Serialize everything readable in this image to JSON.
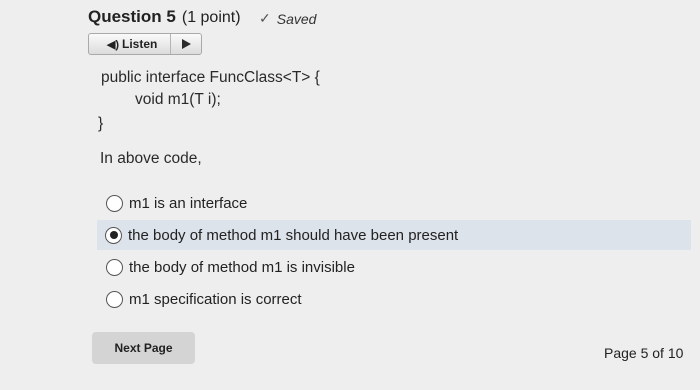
{
  "header": {
    "question": "Question 5",
    "points": "(1 point)",
    "status_icon": "check-icon",
    "status": "Saved"
  },
  "listen": {
    "label": "Listen",
    "speaker_icon": "speaker-icon",
    "play_icon": "play-icon"
  },
  "code": {
    "line1": "public interface FuncClass<T> {",
    "line2": "void m1(T i);",
    "line3": "}"
  },
  "prompt": "In above code,",
  "options": [
    {
      "label": "m1 is an interface",
      "selected": false
    },
    {
      "label": "the body of method m1 should have been present",
      "selected": true
    },
    {
      "label": "the body of method m1 is invisible",
      "selected": false
    },
    {
      "label": "m1 specification is correct",
      "selected": false
    }
  ],
  "footer": {
    "next_label": "Next Page",
    "page_text": "Page 5 of 10"
  }
}
